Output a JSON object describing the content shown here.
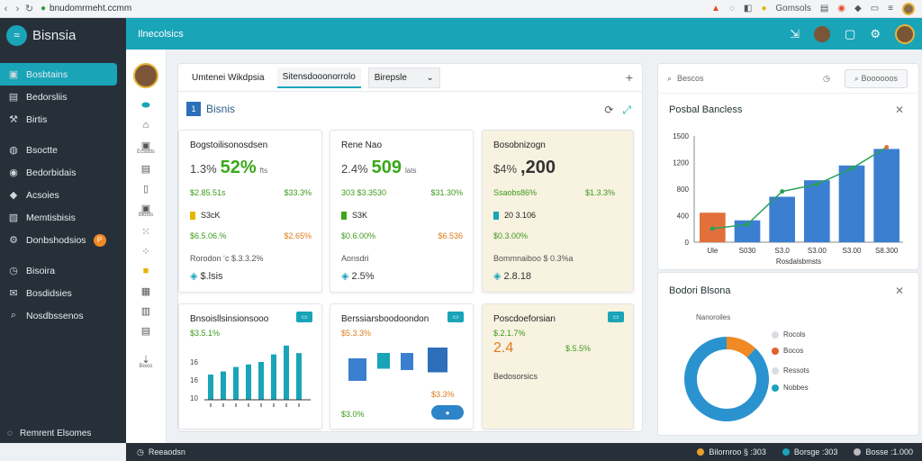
{
  "browser": {
    "url": "bnudomrmeht.ccmm",
    "profile_label": "Gomsols"
  },
  "brand": {
    "name": "Bisnsia"
  },
  "sidebar": {
    "items": [
      {
        "label": "Bosbtains",
        "icon": "dashboard-icon"
      },
      {
        "label": "Bedorsliis",
        "icon": "list-icon"
      },
      {
        "label": "Birtis",
        "icon": "tools-icon"
      },
      {
        "label": "Bsoctte",
        "icon": "globe-icon"
      },
      {
        "label": "Bedorbidais",
        "icon": "user-icon"
      },
      {
        "label": "Acsoies",
        "icon": "diamond-icon"
      },
      {
        "label": "Memtisbisis",
        "icon": "image-icon"
      },
      {
        "label": "Donbshodsios",
        "icon": "settings-icon",
        "badge": "P"
      },
      {
        "label": "Bisoira",
        "icon": "clock-icon"
      },
      {
        "label": "Bosdidsies",
        "icon": "mail-icon"
      },
      {
        "label": "Nosdbssenos",
        "icon": "search-icon"
      }
    ],
    "footer": "Remrent Elsomes"
  },
  "rail": {
    "labels": [
      "Ecsods",
      "Biosts",
      "Bixos"
    ]
  },
  "topbar": {
    "title": "Ilnecolsics"
  },
  "tabs": [
    {
      "label": "Umtenei Wikdpsia"
    },
    {
      "label": "Sitensdooonorrolo"
    },
    {
      "label": "Birepsle"
    }
  ],
  "section": {
    "title": "Bisnis"
  },
  "cards_top": [
    {
      "title": "Bogstoilisonosdsen",
      "prefix": "1.3%",
      "value": "52%",
      "unit": "fts",
      "row1": [
        "$2.85.51s",
        "$33.3%"
      ],
      "row2": "S3cK",
      "row3": [
        "$6.5.06.%",
        "$2.65%"
      ],
      "row4": "Rorodon ‘c $.3.3.2%",
      "row5": "$.lsis",
      "color": "#3aa81a",
      "sqcolor": "#e6b500"
    },
    {
      "title": "Rene Nao",
      "prefix": "2.4%",
      "value": "509",
      "unit": "lats",
      "row1": [
        "303 $3.3530",
        "$31.30%"
      ],
      "row2": "S3K",
      "row3": [
        "$0.6.00%",
        "$6.536"
      ],
      "row4": "Aonsdri",
      "row5": "2.5%",
      "color": "#3aa81a",
      "sqcolor": "#3aa81a"
    },
    {
      "title": "Bosobnizogn",
      "prefix": "$4%",
      "value": ",200",
      "unit": "",
      "row1": [
        "Ssaobs86%",
        "$1.3.3%"
      ],
      "row2": "20 3.106",
      "row3": [
        "$0.3.00%",
        ""
      ],
      "row4": "Bommnaiboo $ 0.3%a",
      "row5": "2.8.18",
      "color": "#333333",
      "sqcolor": "#19a4b8"
    }
  ],
  "cards_bottom": [
    {
      "title": "Bnsoisllsinsionsooo",
      "sub": "$3.5.1%",
      "axis": [
        "16",
        "16",
        "10"
      ],
      "bar_values": [
        4,
        4.5,
        5.2,
        5.6,
        6,
        7.2,
        8.6,
        7.4
      ]
    },
    {
      "title": "Berssiarsboodoondon",
      "sub": "$5.3.3%",
      "sub2": "$3.0%",
      "note": "$3.3%",
      "bar_values": [
        5,
        3.5,
        3.8,
        5.5
      ]
    },
    {
      "title": "Poscdoeforsian",
      "sub": "$.2.1.7%",
      "value": "2.4",
      "value_note": "$.5.5%",
      "foot": "Bedosorsics"
    }
  ],
  "search": {
    "placeholder": "Bescos",
    "button": "Boooooos"
  },
  "bar_chart": {
    "title": "Posbal Bancless"
  },
  "donut_chart": {
    "title": "Bodori Blsona",
    "legend_title": "Nanoroiles",
    "legend": [
      "Rocols",
      "Bocos",
      "Ressots",
      "Nobbes"
    ]
  },
  "footer": {
    "left": "Reeaodsn",
    "items": [
      "Bilornroo § :303",
      "Borsge :303",
      "Bosse :1.000"
    ]
  },
  "chart_data": [
    {
      "type": "bar",
      "title": "Posbal Bancless",
      "categories": [
        "Ule",
        "S030",
        "S3.0",
        "S3.00",
        "S3.00",
        "S8.300"
      ],
      "values": [
        500,
        370,
        770,
        1050,
        1300,
        1580
      ],
      "series": [
        {
          "values": [
            230,
            300,
            860,
            980,
            1250,
            1610
          ]
        }
      ],
      "ylim": [
        0,
        1800
      ],
      "yticks": [
        "0",
        "400",
        "800",
        "1200",
        "1500"
      ],
      "xlabel": "Rosdalsbmsts"
    },
    {
      "type": "pie",
      "title": "Bodori Blsona",
      "categories": [
        "Rocols",
        "Nobbes"
      ],
      "values": [
        12,
        88
      ],
      "colors": [
        "#f08a24",
        "#2a93cf"
      ]
    }
  ]
}
